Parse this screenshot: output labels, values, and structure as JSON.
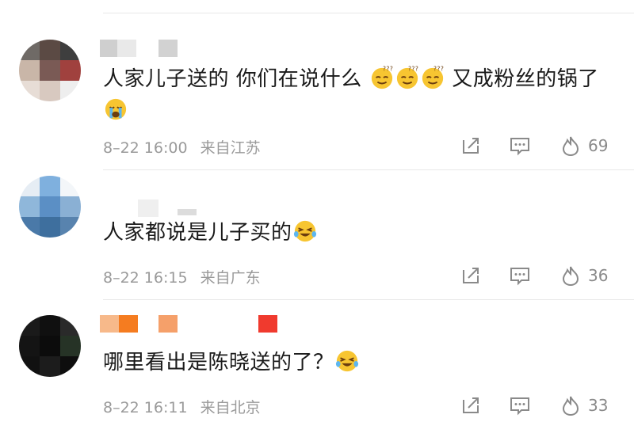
{
  "comments": [
    {
      "text_parts": [
        "人家儿子送的 你们在说什么",
        "又成粉丝的锅了"
      ],
      "emojis_inline": [
        "smirk-emoji",
        "smirk-emoji",
        "smirk-emoji"
      ],
      "emoji_end": "crying-emoji",
      "date": "8–22 16:00",
      "location": "来自江苏",
      "likes": "69"
    },
    {
      "text": "人家都说是儿子买的",
      "emoji_end": "laughing-tears-emoji",
      "date": "8–22 16:15",
      "location": "来自广东",
      "likes": "36"
    },
    {
      "text": "哪里看出是陈晓送的了？",
      "emoji_end": "laughing-tears-emoji",
      "date": "8–22 16:11",
      "location": "来自北京",
      "likes": "33"
    }
  ],
  "icons": {
    "share": "share-icon",
    "reply": "comment-icon",
    "like": "flame-like-icon"
  },
  "colors": {
    "text": "#1a1a1a",
    "meta": "#9a9a9a",
    "divider": "#e8e8e8",
    "username_orange": "#f57c20",
    "username_red": "#f03a2e"
  }
}
